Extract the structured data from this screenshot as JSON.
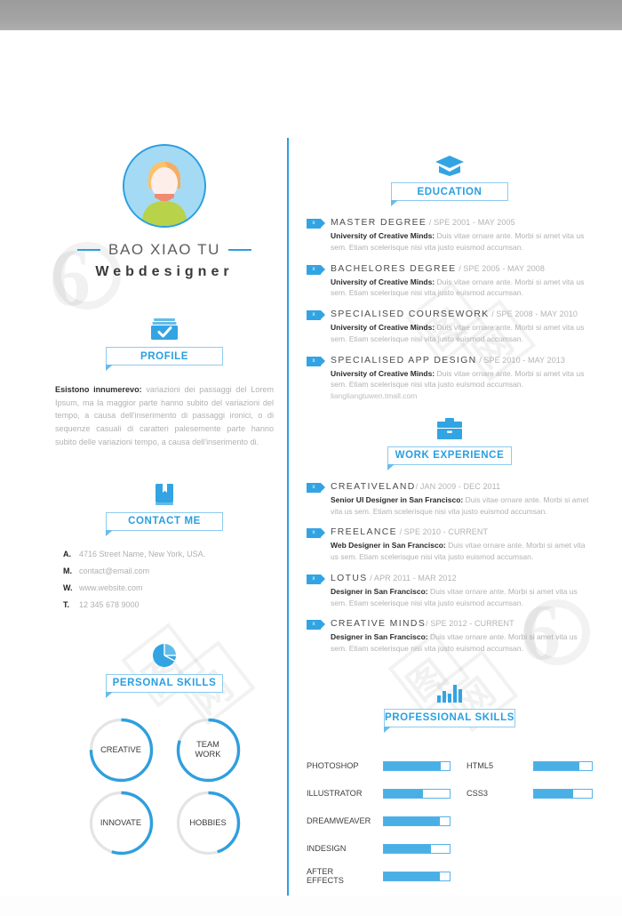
{
  "theme": {
    "accent": "#2a9fe0",
    "accent_light": "#8ecbf0",
    "bar_fill": "#4aafe5",
    "text_dark": "#3a3a3a",
    "text_muted": "#b2b2b2"
  },
  "header": {
    "name": "BAO XIAO TU",
    "job_title": "Webdesigner"
  },
  "profile": {
    "icon": "folder-check-icon",
    "title": "PROFILE",
    "lead": "Esistono innumerevo:",
    "body": " variazioni dei passaggi del Lorem Ipsum, ma la maggior parte hanno subito del variazioni del tempo, a causa dell'inserimento di passaggi ironici, o di sequenze casuali di caratteri palesemente parte hanno subito delle variazioni tempo, a causa dell'inserimento di."
  },
  "contact": {
    "icon": "book-icon",
    "title": "CONTACT ME",
    "items": [
      {
        "key": "A.",
        "value": "4716 Street Name, New York, USA."
      },
      {
        "key": "M.",
        "value": "contact@email.com"
      },
      {
        "key": "W.",
        "value": "www.website.com"
      },
      {
        "key": "T.",
        "value": "12 345 678 9000"
      }
    ]
  },
  "personal_skills": {
    "icon": "pie-chart-icon",
    "title": "PERSONAL SKILLS",
    "rings": [
      {
        "label": "CREATIVE",
        "percent": 75
      },
      {
        "label": "TEAM\nWORK",
        "percent": 80
      },
      {
        "label": "INNOVATE",
        "percent": 55
      },
      {
        "label": "HOBBIES",
        "percent": 45
      }
    ]
  },
  "education": {
    "icon": "graduation-cap-icon",
    "title": "EDUCATION",
    "entries": [
      {
        "tag": "x",
        "title": "MASTER DEGREE",
        "meta": " / SPE 2001 - MAY 2005",
        "org": "University of Creative Minds:",
        "desc": " Duis vitae ornare ante. Morbi si amet vita us sem. Etiam scelerisque nisi vita justo euismod accumsan.",
        "extra": ""
      },
      {
        "tag": "x",
        "title": "BACHELORES DEGREE",
        "meta": " / SPE 2005 - MAY 2008",
        "org": "University of Creative Minds:",
        "desc": " Duis vitae ornare ante. Morbi si amet vita us sem. Etiam scelerisque nisi vita justo euismod accumsan.",
        "extra": ""
      },
      {
        "tag": "x",
        "title": "SPECIALISED COURSEWORK",
        "meta": " / SPE 2008 - MAY 2010",
        "org": "University of Creative Minds:",
        "desc": " Duis vitae ornare ante. Morbi si amet vita us sem. Etiam scelerisque nisi vita justo euismod accumsan.",
        "extra": ""
      },
      {
        "tag": "x",
        "title": "SPECIALISED APP DESIGN",
        "meta": " / SPE 2010 - MAY 2013",
        "org": "University of Creative Minds:",
        "desc": " Duis vitae ornare ante. Morbi si amet vita us sem. Etiam scelerisque nisi vita justo euismod accumsan.",
        "extra": "liangliangtuwen.tmall.com"
      }
    ]
  },
  "work_experience": {
    "icon": "briefcase-icon",
    "title": "WORK EXPERIENCE",
    "entries": [
      {
        "tag": "x",
        "title": "CREATIVELAND",
        "meta": "/ JAN 2009 - DEC 2011",
        "org": "Senior UI Designer in San Francisco:",
        "desc": " Duis vitae ornare ante. Morbi si amet vita us sem. Etiam scelerisque nisi vita justo euismod accumsan.",
        "extra": ""
      },
      {
        "tag": "x",
        "title": "FREELANCE",
        "meta": " / SPE 2010 - CURRENT",
        "org": "Web Designer in San Francisco:",
        "desc": " Duis vitae ornare ante. Morbi si amet vita us sem. Etiam scelerisque nisi vita justo euismod accumsan.",
        "extra": ""
      },
      {
        "tag": "x",
        "title": "LOTUS",
        "meta": " / APR 2011 - MAR 2012",
        "org": "Designer in San Francisco:",
        "desc": " Duis vitae ornare ante. Morbi si amet vita us sem. Etiam scelerisque nisi vita justo euismod accumsan.",
        "extra": ""
      },
      {
        "tag": "x",
        "title": "CREATIVE MINDS",
        "meta": "/ SPE 2012 - CURRENT",
        "org": "Designer in San Francisco:",
        "desc": " Duis vitae ornare ante. Morbi si amet vita us sem. Etiam scelerisque nisi vita justo euismod accumsan.",
        "extra": ""
      }
    ]
  },
  "professional_skills": {
    "icon": "bar-chart-icon",
    "title": "PROFESSIONAL SKILLS",
    "column_left": [
      {
        "label": "PHOTOSHOP",
        "percent": 87
      },
      {
        "label": "ILLUSTRATOR",
        "percent": 60
      },
      {
        "label": "DREAMWEAVER",
        "percent": 85
      },
      {
        "label": "INDESIGN",
        "percent": 72
      },
      {
        "label": "AFTER\nEFFECTS",
        "percent": 85
      }
    ],
    "column_right": [
      {
        "label": "HTML5",
        "percent": 78
      },
      {
        "label": "CSS3",
        "percent": 68
      }
    ]
  },
  "watermark": {
    "text_1": "6",
    "text_2": "图",
    "text_3": "网"
  }
}
